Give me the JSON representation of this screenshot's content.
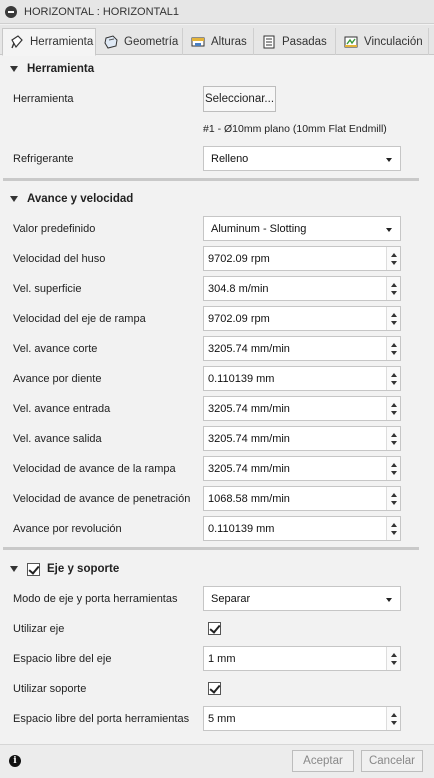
{
  "window": {
    "title": "HORIZONTAL : HORIZONTAL1"
  },
  "tabs": [
    {
      "label": "Herramienta",
      "icon": "tool-icon"
    },
    {
      "label": "Geometría",
      "icon": "geometry-icon"
    },
    {
      "label": "Alturas",
      "icon": "heights-icon"
    },
    {
      "label": "Pasadas",
      "icon": "passes-icon"
    },
    {
      "label": "Vinculación",
      "icon": "linking-icon"
    }
  ],
  "herramienta": {
    "section_title": "Herramienta",
    "tool_label": "Herramienta",
    "select_button": "Seleccionar...",
    "tool_description": "#1 - Ø10mm plano (10mm Flat Endmill)",
    "coolant_label": "Refrigerante",
    "coolant_value": "Relleno"
  },
  "feeds": {
    "section_title": "Avance y velocidad",
    "preset_label": "Valor predefinido",
    "preset_value": "Aluminum - Slotting",
    "rows": [
      {
        "label": "Velocidad del huso",
        "value": "9702.09 rpm"
      },
      {
        "label": "Vel. superficie",
        "value": "304.8 m/min"
      },
      {
        "label": "Velocidad del eje de rampa",
        "value": "9702.09 rpm"
      },
      {
        "label": "Vel. avance corte",
        "value": "3205.74 mm/min"
      },
      {
        "label": "Avance por diente",
        "value": "0.110139 mm"
      },
      {
        "label": "Vel. avance entrada",
        "value": "3205.74 mm/min"
      },
      {
        "label": "Vel. avance salida",
        "value": "3205.74 mm/min"
      },
      {
        "label": "Velocidad de avance de la rampa",
        "value": "3205.74 mm/min"
      },
      {
        "label": "Velocidad de avance de penetración",
        "value": "1068.58 mm/min"
      },
      {
        "label": "Avance por revolución",
        "value": "0.110139 mm"
      }
    ]
  },
  "spindle": {
    "section_title": "Eje y soporte",
    "section_checked": true,
    "mode_label": "Modo de eje y porta herramientas",
    "mode_value": "Separar",
    "use_shaft_label": "Utilizar eje",
    "use_shaft_checked": true,
    "shaft_clearance_label": "Espacio libre del eje",
    "shaft_clearance_value": "1 mm",
    "use_holder_label": "Utilizar soporte",
    "use_holder_checked": true,
    "holder_clearance_label": "Espacio libre del porta herramientas",
    "holder_clearance_value": "5 mm"
  },
  "footer": {
    "info_icon": "info-icon",
    "ok_label": "Aceptar",
    "cancel_label": "Cancelar"
  }
}
